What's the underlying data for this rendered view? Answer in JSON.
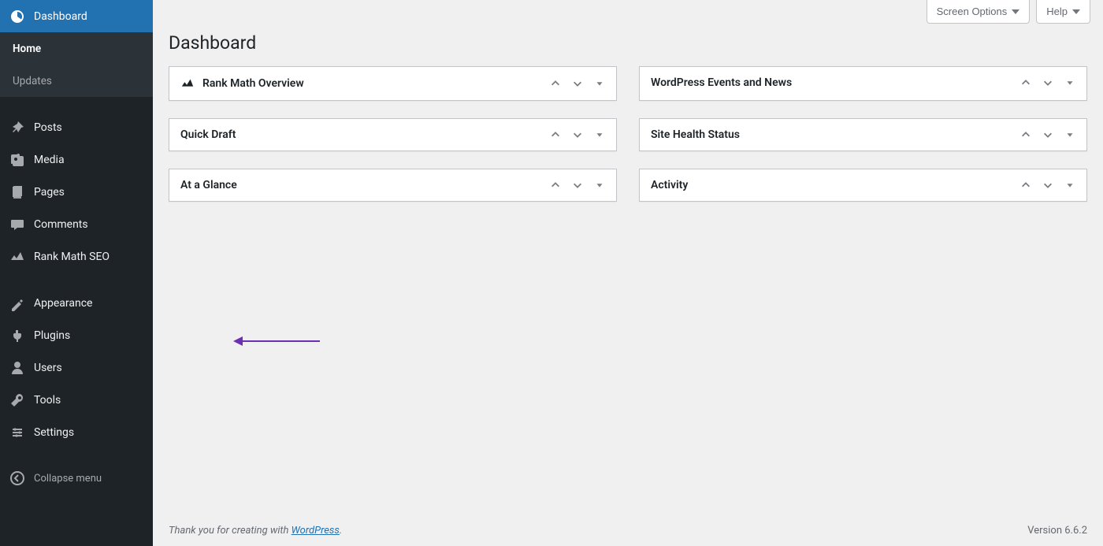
{
  "sidebar": {
    "dashboard": "Dashboard",
    "sub_home": "Home",
    "sub_updates": "Updates",
    "posts": "Posts",
    "media": "Media",
    "pages": "Pages",
    "comments": "Comments",
    "rankmath": "Rank Math SEO",
    "appearance": "Appearance",
    "plugins": "Plugins",
    "users": "Users",
    "tools": "Tools",
    "settings": "Settings",
    "collapse": "Collapse menu"
  },
  "topbar": {
    "screen_options": "Screen Options",
    "help": "Help"
  },
  "page": {
    "title": "Dashboard"
  },
  "widgets": {
    "rankmath_overview": "Rank Math Overview",
    "wp_events": "WordPress Events and News",
    "quick_draft": "Quick Draft",
    "site_health": "Site Health Status",
    "at_a_glance": "At a Glance",
    "activity": "Activity"
  },
  "footer": {
    "thankyou_prefix": "Thank you for creating with ",
    "thankyou_link": "WordPress",
    "thankyou_suffix": ".",
    "version": "Version 6.6.2"
  }
}
